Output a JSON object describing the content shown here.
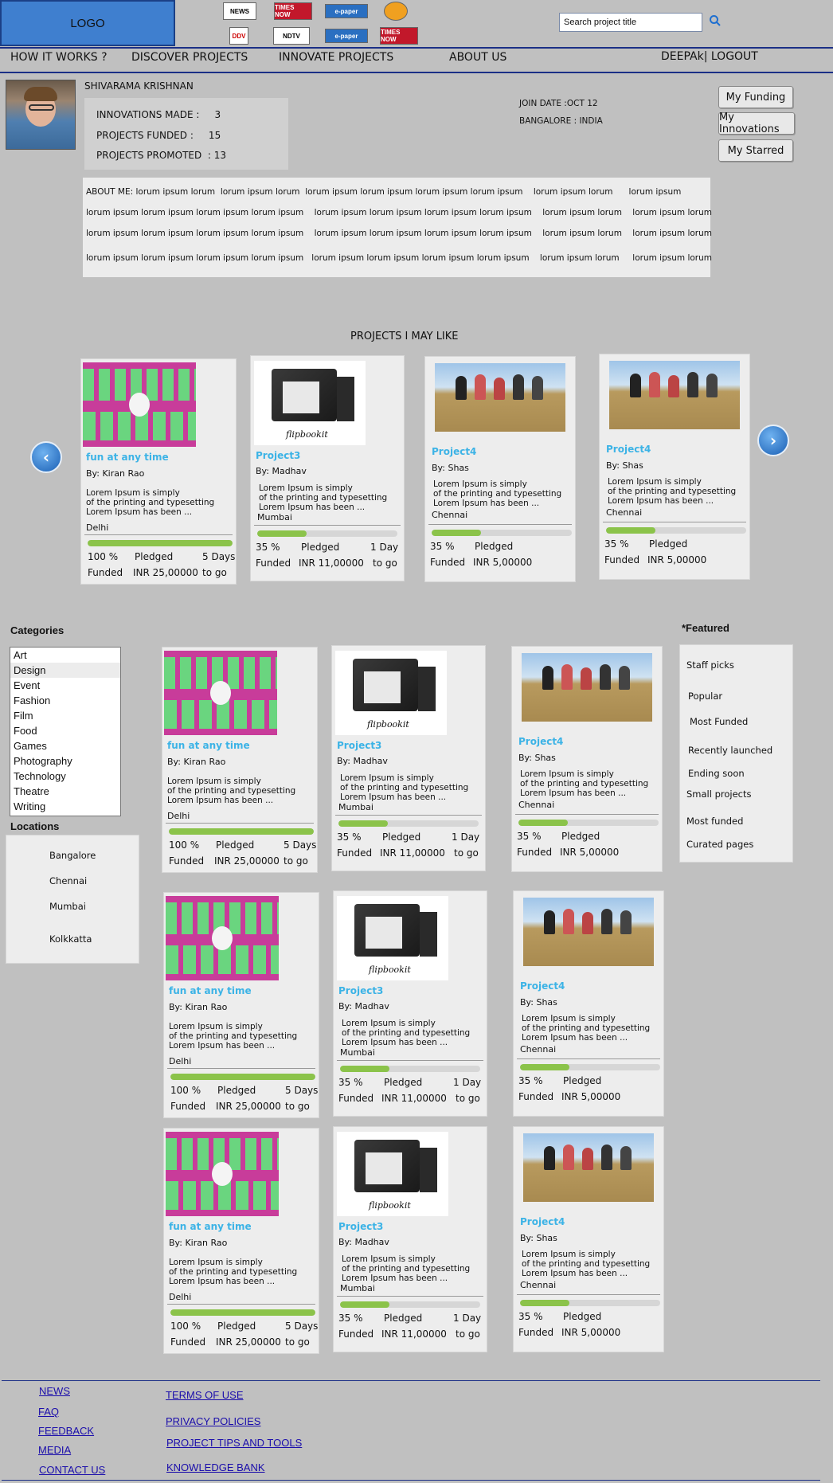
{
  "header": {
    "logo": "LOGO",
    "media_logos": [
      {
        "label": "NEWS",
        "fg": "#111",
        "bg": "#fff"
      },
      {
        "label": "TIMES NOW",
        "fg": "#fff",
        "bg": "#c2182b"
      },
      {
        "label": "e-paper",
        "fg": "#fff",
        "bg": "#2a6fc1"
      },
      {
        "label": "",
        "fg": "#fff",
        "bg": "#f0a020"
      },
      {
        "label": "DDV",
        "fg": "#c00",
        "bg": "#fff"
      },
      {
        "label": "NDTV",
        "fg": "#111",
        "bg": "#fff"
      },
      {
        "label": "e-paper",
        "fg": "#fff",
        "bg": "#2a6fc1"
      },
      {
        "label": "TIMES NOW",
        "fg": "#fff",
        "bg": "#c2182b"
      }
    ],
    "search": {
      "value": "Search project title"
    }
  },
  "nav": {
    "how": "HOW IT WORKS ?",
    "discover": "DISCOVER PROJECTS",
    "innovate": "INNOVATE PROJECTS",
    "about": "ABOUT US",
    "user": "DEEPAk| LOGOUT"
  },
  "profile": {
    "name": "SHIVARAMA KRISHNAN",
    "innovations": "INNOVATIONS MADE :     3",
    "funded": "PROJECTS FUNDED :     15",
    "promoted": "PROJECTS PROMOTED  : 13",
    "join": "JOIN DATE :OCT 12",
    "location": "BANGALORE : INDIA",
    "buttons": {
      "funding": "My Funding",
      "innovations": "My Innovations",
      "starred": "My Starred"
    },
    "about": [
      "ABOUT ME: lorum ipsum lorum  lorum ipsum lorum  lorum ipsum lorum ipsum lorum ipsum lorum ipsum    lorum ipsum lorum      lorum ipsum",
      "lorum ipsum lorum ipsum lorum ipsum lorum ipsum    lorum ipsum lorum ipsum lorum ipsum lorum ipsum    lorum ipsum lorum    lorum ipsum lorum",
      "lorum ipsum lorum ipsum lorum ipsum lorum ipsum    lorum ipsum lorum ipsum lorum ipsum lorum ipsum    lorum ipsum lorum    lorum ipsum lorum",
      "lorum ipsum lorum ipsum lorum ipsum lorum ipsum   lorum ipsum lorum ipsum lorum ipsum lorum ipsum    lorum ipsum lorum     lorum ipsum lorum"
    ]
  },
  "may_like": {
    "heading": "PROJECTS I MAY LIKE"
  },
  "projects": {
    "p1": {
      "title": "fun at any time",
      "by": "By:  Kiran Rao",
      "desc1": "Lorem Ipsum is simply",
      "desc2": "of the printing and typesetting",
      "desc3": "Lorem Ipsum has been ...",
      "loc": "Delhi",
      "pct": "100 %",
      "funded": "Funded",
      "pledged": "Pledged",
      "amount": "INR 25,00000",
      "days1": "5 Days",
      "days2": "to go",
      "progress": 1.0,
      "image": "band-poster"
    },
    "p2": {
      "title": "Project3",
      "by": "By:  Madhav",
      "desc1": "Lorem Ipsum is simply",
      "desc2": "of the printing and typesetting",
      "desc3": "Lorem Ipsum has been ...",
      "loc": "Mumbai",
      "pct": "35 %",
      "funded": "Funded",
      "pledged": "Pledged",
      "amount": "INR 11,00000",
      "days1": "1 Day",
      "days2": "to go",
      "progress": 0.35,
      "image": "flipbookit-box",
      "caption": "flipbookit"
    },
    "p3": {
      "title": "Project4",
      "by": "By:  Shas",
      "desc1": "Lorem Ipsum is simply",
      "desc2": "of the printing and typesetting",
      "desc3": "Lorem Ipsum has been ...",
      "loc": "Chennai",
      "pct": "35 %",
      "funded": "Funded",
      "pledged": "Pledged",
      "amount": "INR 5,00000",
      "progress": 0.35,
      "image": "group-in-field"
    }
  },
  "sidebar": {
    "categories_title": "Categories",
    "categories": [
      "Art",
      "Design",
      "Event",
      "Fashion",
      "Film",
      "Food",
      "Games",
      "Photography",
      "Technology",
      "Theatre",
      "Writing"
    ],
    "locations_title": "Locations",
    "locations": [
      "Bangalore",
      "Chennai",
      "Mumbai",
      "Kolkkatta"
    ]
  },
  "featured": {
    "title": "*Featured",
    "items": [
      "Staff picks",
      "Popular",
      "Most Funded",
      "Recently launched",
      "Ending soon",
      "Small projects",
      "Most funded",
      "Curated pages"
    ]
  },
  "footer": {
    "left": [
      "NEWS",
      "FAQ",
      "FEEDBACK",
      "MEDIA",
      "CONTACT US"
    ],
    "right": [
      "TERMS OF USE",
      "PRIVACY POLICIES",
      "PROJECT TIPS AND TOOLS",
      "KNOWLEDGE BANK"
    ]
  },
  "colors": {
    "logo_bg": "#3f7fcf",
    "nav_line": "#1b2f86",
    "title_blue": "#3cb3e6",
    "progress": "#8bc34a",
    "link": "#1a0dab"
  }
}
